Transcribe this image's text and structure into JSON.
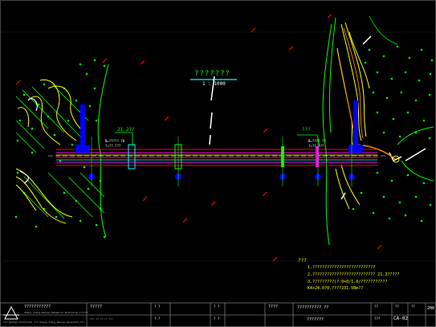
{
  "drawing": {
    "title": "???????",
    "scale": "1 : 1000",
    "left_station": "21.2??",
    "left_pier_label": "B=?????.?0",
    "left_pier_sub": "?=??.???",
    "right_station": "???",
    "right_pier_label": "B=????.??",
    "right_pier_sub": "?=??.???"
  },
  "notes": {
    "heading": "???",
    "line1": "1.??????????????????????????",
    "line2": "2.?????????????????????????? 21.3?????",
    "line3": "3.?????????(?.0+0/1.0/???????????",
    "line4": "K4+24.0?0.????231.08m??"
  },
  "title_block": {
    "company_name": "???????????",
    "company_sub1": "Sheng Jiang Design Research Institute ??????",
    "company_sub2": "??? Design Institute ??? Sheng Jiang Design Research ???",
    "project_label": "?????",
    "project_sub": "??? ?? ?? ?? ???",
    "sig1": "? ?",
    "sig2": "? ?",
    "sig3": "? ?",
    "sig4": "? ?",
    "drawing_title_label": "????",
    "drawing_title": "?????????? ??",
    "drawing_sub": "???????",
    "sheet_label": "??",
    "sheet_no": "CA-02",
    "scale_label": "??",
    "scale_val": "???",
    "date_label": "??",
    "date_val": "200"
  },
  "colors": {
    "background": "#000000",
    "contour_yellow": "#ffff00",
    "contour_green": "#00ff00",
    "road_red": "#ff0000",
    "road_magenta": "#ff00ff",
    "pier_blue": "#0000ff",
    "text_white": "#ffffff",
    "frame_gray": "#555555"
  }
}
